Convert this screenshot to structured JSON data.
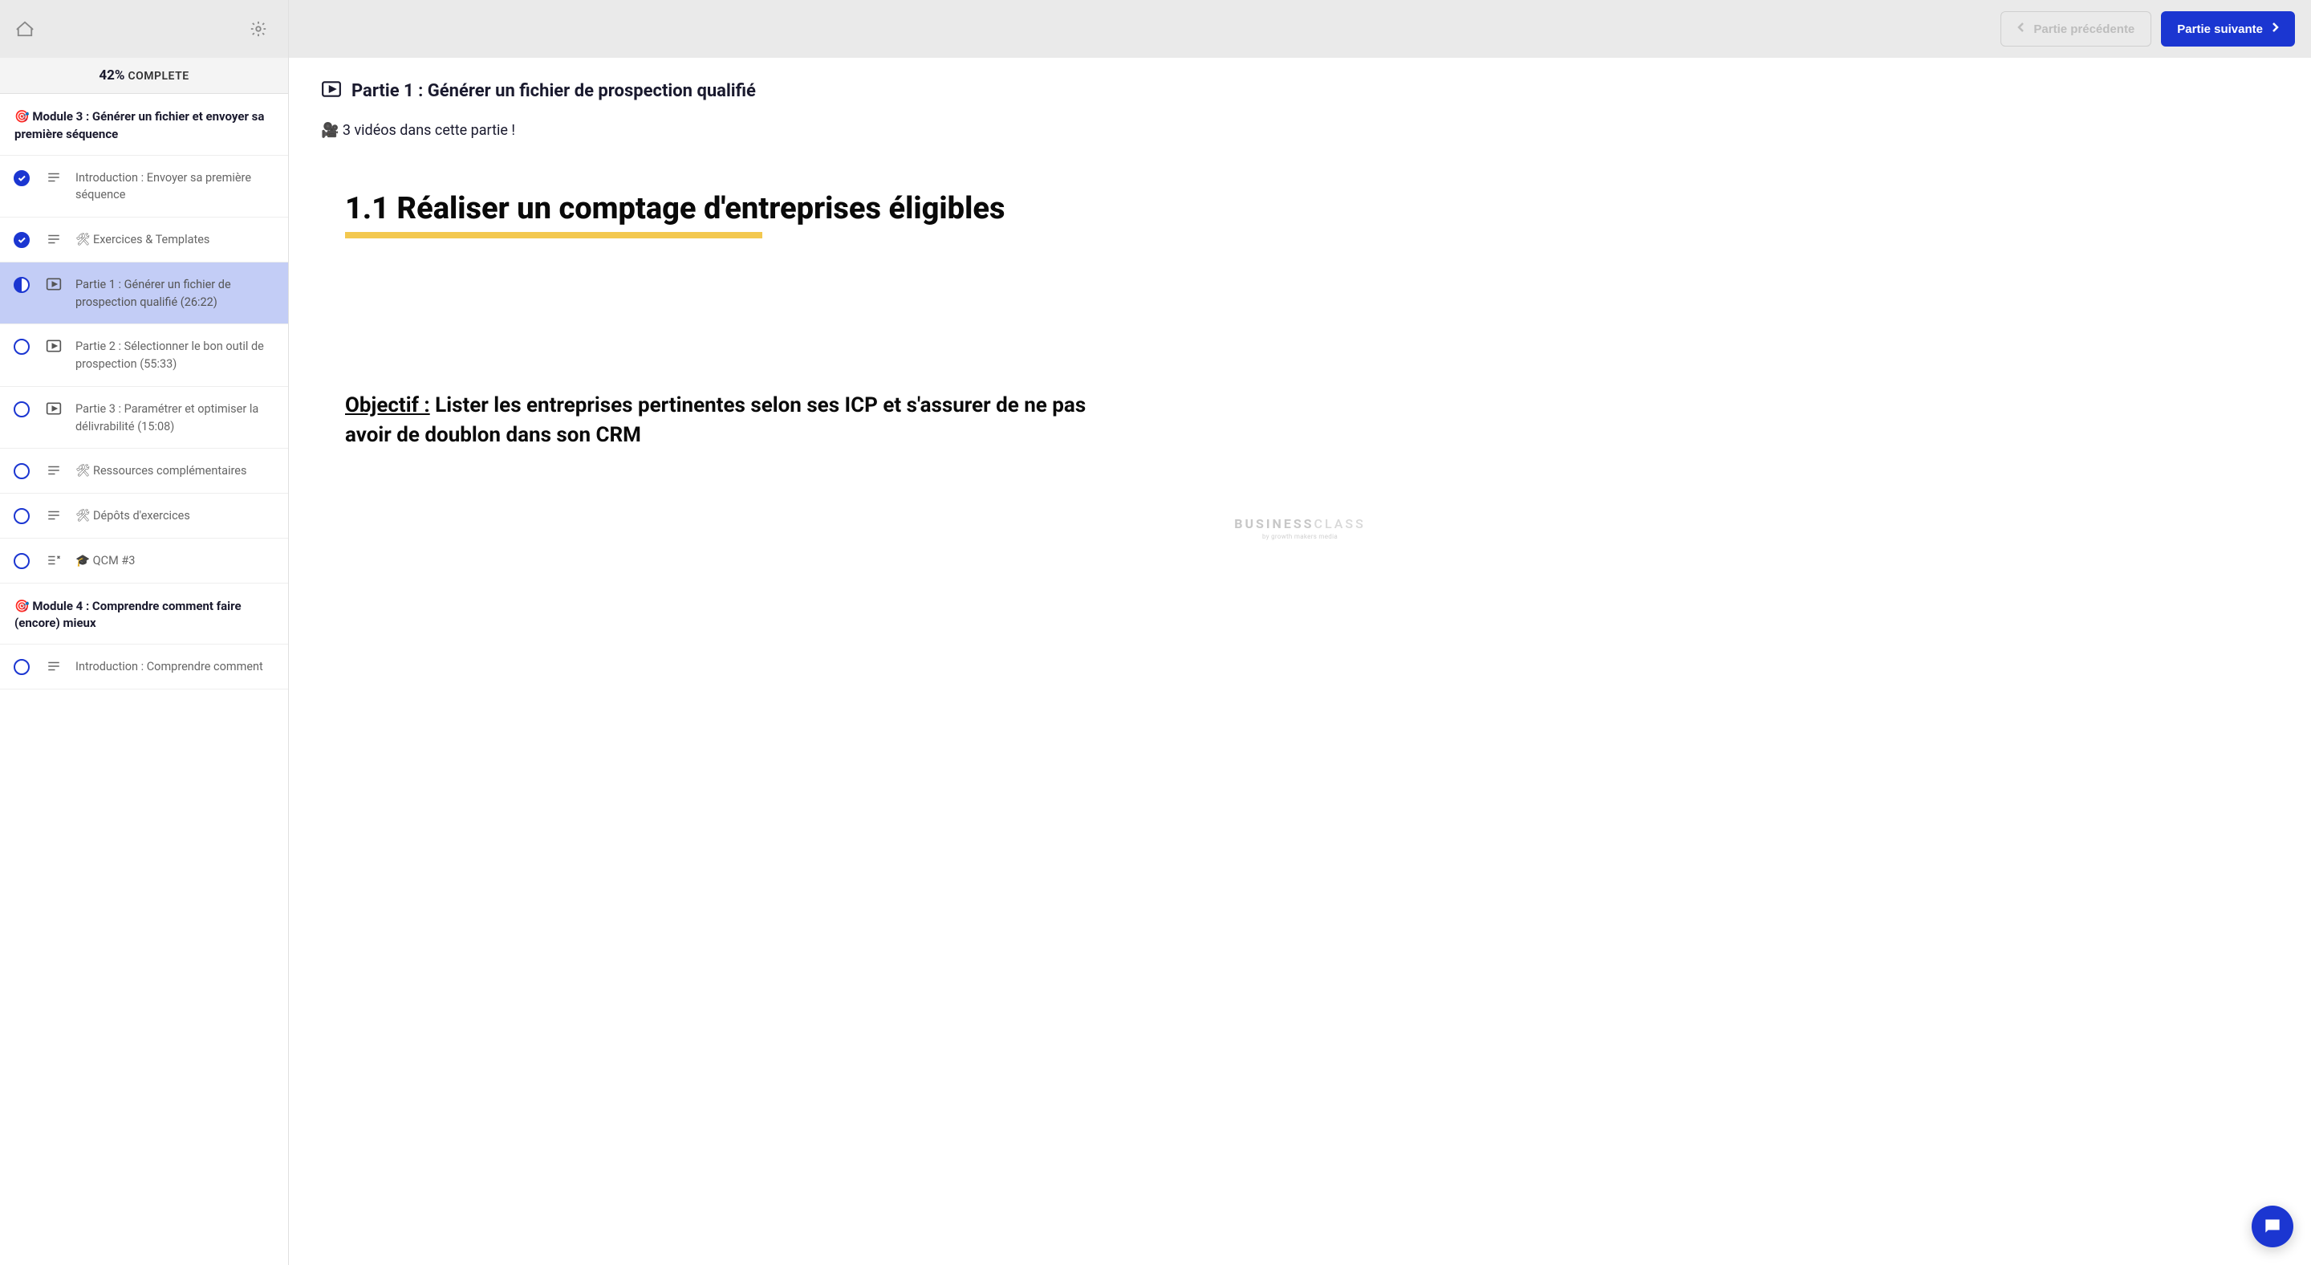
{
  "progress": {
    "percent": "42%",
    "label": "COMPLETE"
  },
  "nav": {
    "prev": "Partie précédente",
    "next": "Partie suivante"
  },
  "module3": {
    "title": "🎯 Module 3 : Générer un fichier et envoyer sa première séquence",
    "items": [
      {
        "label": "Introduction : Envoyer sa première séquence",
        "type": "text",
        "status": "done"
      },
      {
        "label": "🛠 Exercices & Templates",
        "type": "text",
        "status": "done"
      },
      {
        "label": "Partie 1 : Générer un fichier de prospection qualifié (26:22)",
        "type": "video",
        "status": "half",
        "active": true
      },
      {
        "label": "Partie 2 : Sélectionner le bon outil de prospection (55:33)",
        "type": "video",
        "status": "empty"
      },
      {
        "label": "Partie 3 : Paramétrer et optimiser la délivrabilité (15:08)",
        "type": "video",
        "status": "empty"
      },
      {
        "label": "🛠 Ressources complémentaires",
        "type": "text",
        "status": "empty"
      },
      {
        "label": "🛠 Dépôts d'exercices",
        "type": "text",
        "status": "empty"
      },
      {
        "label": "🎓 QCM #3",
        "type": "quiz",
        "status": "empty"
      }
    ]
  },
  "module4": {
    "title": "🎯 Module 4 : Comprendre comment faire (encore) mieux",
    "items": [
      {
        "label": "Introduction : Comprendre comment",
        "type": "text",
        "status": "empty"
      }
    ]
  },
  "content": {
    "part_title": "Partie 1 : Générer un fichier de prospection qualifié",
    "videos_note": "🎥 3 vidéos dans cette partie !",
    "slide_heading": "1.1  Réaliser un comptage d'entreprises éligibles",
    "objectif_label": "Objectif :",
    "objectif_text": " Lister les entreprises pertinentes selon ses ICP et s'assurer de ne pas avoir de doublon dans son CRM",
    "brand_a": "BUSINESS",
    "brand_b": "CLASS",
    "brand_tag": "by growth makers media"
  }
}
